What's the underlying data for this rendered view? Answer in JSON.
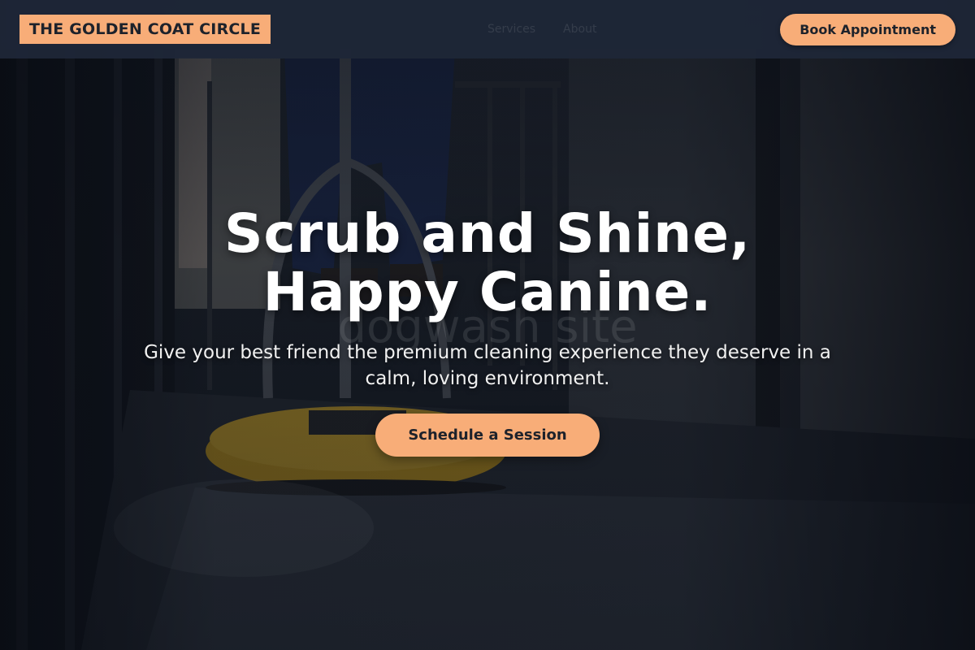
{
  "header": {
    "brand": "THE GOLDEN COAT CIRCLE",
    "nav_items": [
      "Services",
      "About"
    ],
    "cta_label": "Book Appointment"
  },
  "hero": {
    "title_line1": "Scrub and Shine,",
    "title_line2": "Happy Canine.",
    "subtitle": "Give your best friend the premium cleaning experience they deserve in a calm, loving environment.",
    "cta_label": "Schedule a Session",
    "watermark": "dogwash site"
  },
  "colors": {
    "accent": "#f8ad78",
    "header_bg": "#1e2637",
    "text_dark": "#1d222b"
  }
}
